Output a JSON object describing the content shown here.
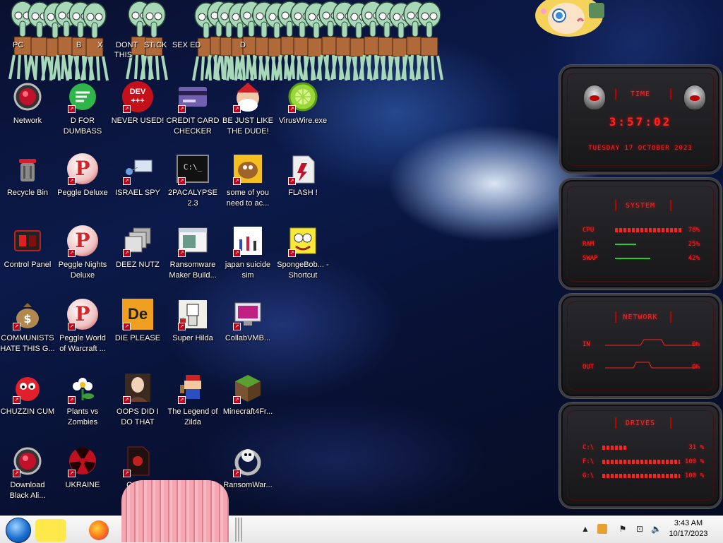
{
  "squid_band_labels": [
    "PC",
    "B",
    "X",
    "DONT",
    "STICK",
    "THIS",
    "SEX ED",
    "D"
  ],
  "icons": [
    {
      "id": "network",
      "label": "Network",
      "col": 0,
      "row": 0,
      "kind": "network-icon"
    },
    {
      "id": "d-for-dumbass",
      "label": "D FOR DUMBASS",
      "col": 1,
      "row": 0,
      "kind": "green-bubble-icon"
    },
    {
      "id": "never-used",
      "label": "NEVER USED!",
      "col": 2,
      "row": 0,
      "kind": "dev-cpp-icon",
      "badge": "DEV\n+++"
    },
    {
      "id": "credit-card-checker",
      "label": "CREDIT CARD CHECKER",
      "col": 3,
      "row": 0,
      "kind": "credit-card-icon"
    },
    {
      "id": "be-just-like-the-dude",
      "label": "BE JUST LIKE THE DUDE!",
      "col": 4,
      "row": 0,
      "kind": "santa-icon"
    },
    {
      "id": "viruswire",
      "label": "VirusWire.exe",
      "col": 5,
      "row": 0,
      "kind": "lime-icon"
    },
    {
      "id": "recycle-bin",
      "label": "Recycle Bin",
      "col": 0,
      "row": 1,
      "kind": "recycle-bin-icon"
    },
    {
      "id": "peggle-deluxe",
      "label": "Peggle Deluxe",
      "col": 1,
      "row": 1,
      "kind": "peggle-icon",
      "badge": "P"
    },
    {
      "id": "israel-spy",
      "label": "ISRAEL SPY",
      "col": 2,
      "row": 1,
      "kind": "network-pc-icon"
    },
    {
      "id": "2pacalypse",
      "label": "2PACALYPSE 2.3",
      "col": 3,
      "row": 1,
      "kind": "cmd-icon",
      "badge": "C:\\_"
    },
    {
      "id": "some-of-you",
      "label": "some of you need to ac...",
      "col": 4,
      "row": 1,
      "kind": "scooby-icon"
    },
    {
      "id": "flash",
      "label": "FLASH !",
      "col": 5,
      "row": 1,
      "kind": "flash-doc-icon"
    },
    {
      "id": "control-panel",
      "label": "Control Panel",
      "col": 0,
      "row": 2,
      "kind": "control-panel-icon"
    },
    {
      "id": "peggle-nights",
      "label": "Peggle Nights Deluxe",
      "col": 1,
      "row": 2,
      "kind": "peggle-icon",
      "badge": "P"
    },
    {
      "id": "deez-nutz",
      "label": "DEEZ NUTZ",
      "col": 2,
      "row": 2,
      "kind": "windows-stack-icon"
    },
    {
      "id": "ransomware-maker",
      "label": "Ransomware Maker Build...",
      "col": 3,
      "row": 2,
      "kind": "window-app-icon"
    },
    {
      "id": "japan-suicide-sim",
      "label": "japan suicide sim",
      "col": 4,
      "row": 2,
      "kind": "japan-sim-icon"
    },
    {
      "id": "spongebob-shortcut",
      "label": "SpongeBob... - Shortcut",
      "col": 5,
      "row": 2,
      "kind": "spongebob-icon"
    },
    {
      "id": "communists",
      "label": "COMMUNISTS HATE THIS G...",
      "col": 0,
      "row": 3,
      "kind": "money-bag-icon"
    },
    {
      "id": "peggle-world",
      "label": "Peggle World of Warcraft ...",
      "col": 1,
      "row": 3,
      "kind": "peggle-icon",
      "badge": "P"
    },
    {
      "id": "die-please",
      "label": "DIE PLEASE",
      "col": 2,
      "row": 3,
      "kind": "de-icon",
      "badge": "De"
    },
    {
      "id": "super-hilda",
      "label": "Super Hilda",
      "col": 3,
      "row": 3,
      "kind": "pixel-art-icon"
    },
    {
      "id": "collabvmb",
      "label": "CollabVMB...",
      "col": 4,
      "row": 3,
      "kind": "monitor-icon"
    },
    {
      "id": "chuzzin-cum",
      "label": "CHUZZIN CUM",
      "col": 0,
      "row": 4,
      "kind": "chuzzle-icon"
    },
    {
      "id": "plants-vs-zombies",
      "label": "Plants vs Zombies",
      "col": 1,
      "row": 4,
      "kind": "flower-icon"
    },
    {
      "id": "oops-did-i",
      "label": "OOPS DID I DO THAT",
      "col": 2,
      "row": 4,
      "kind": "portrait-icon"
    },
    {
      "id": "legend-of-zilda",
      "label": "The Legend of Zilda",
      "col": 3,
      "row": 4,
      "kind": "mario-icon"
    },
    {
      "id": "minecraft4fr",
      "label": "Minecraft4Fr...",
      "col": 4,
      "row": 4,
      "kind": "grass-block-icon"
    },
    {
      "id": "download-black-ali",
      "label": "Download Black Ali...",
      "col": 0,
      "row": 5,
      "kind": "network-icon"
    },
    {
      "id": "ukraine",
      "label": "UKRAINE",
      "col": 1,
      "row": 5,
      "kind": "radiation-icon"
    },
    {
      "id": "oops",
      "label": "OOPS",
      "col": 2,
      "row": 5,
      "kind": "dark-file-icon"
    },
    {
      "id": "ransomwar",
      "label": "RansomWar...",
      "col": 4,
      "row": 5,
      "kind": "skull-ring-icon"
    }
  ],
  "widget": {
    "time": {
      "title": "TIME",
      "clock": "3:57:02",
      "date": "TUESDAY 17 OCTOBER 2023"
    },
    "system": {
      "title": "SYSTEM",
      "rows": [
        {
          "label": "CPU",
          "value": "78%",
          "level": 0.78,
          "style": "red"
        },
        {
          "label": "RAM",
          "value": "25%",
          "level": 0.25,
          "style": "green"
        },
        {
          "label": "SWAP",
          "value": "42%",
          "level": 0.42,
          "style": "green"
        }
      ]
    },
    "network": {
      "title": "NETWORK",
      "rows": [
        {
          "label": "IN",
          "value": "0%"
        },
        {
          "label": "OUT",
          "value": "0%"
        }
      ]
    },
    "drives": {
      "title": "DRIVES",
      "rows": [
        {
          "label": "C:\\",
          "value": "31 %",
          "level": 0.31
        },
        {
          "label": "F:\\",
          "value": "100 %",
          "level": 1.0
        },
        {
          "label": "G:\\",
          "value": "100 %",
          "level": 1.0
        }
      ]
    }
  },
  "taskbar": {
    "time": "3:43 AM",
    "date": "10/17/2023",
    "tray_icons": [
      "chevron-up-icon",
      "app-tray-icon",
      "flag-icon",
      "network-tray-icon",
      "volume-icon"
    ]
  },
  "colors": {
    "widget_red": "#ff2424",
    "taskbar_bg": "#f0f0f0",
    "shortcut_arrow": "#c0001a"
  }
}
